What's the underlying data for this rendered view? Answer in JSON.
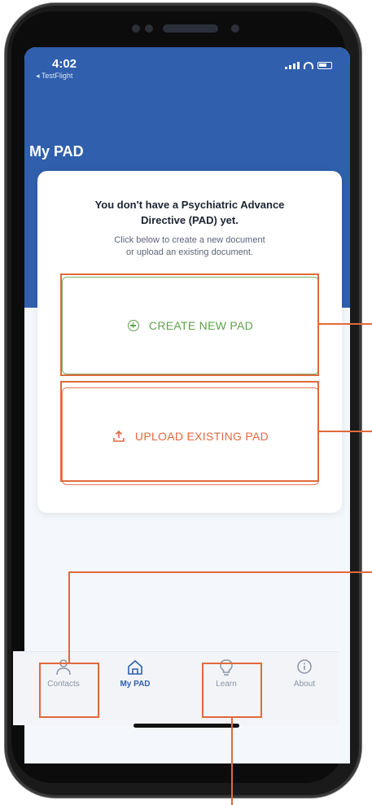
{
  "status_bar": {
    "time": "4:02",
    "back_app": "◂ TestFlight"
  },
  "header": {
    "title": "My PAD"
  },
  "card": {
    "title_line1": "You don't have a Psychiatric Advance",
    "title_line2": "Directive (PAD) yet.",
    "subtitle_line1": "Click below to create a new document",
    "subtitle_line2": "or upload an existing document."
  },
  "actions": {
    "create_label": "CREATE NEW PAD",
    "upload_label": "UPLOAD EXISTING PAD"
  },
  "tabs": [
    {
      "label": "Contacts",
      "icon": "person-icon"
    },
    {
      "label": "My PAD",
      "icon": "home-icon",
      "active": true
    },
    {
      "label": "Learn",
      "icon": "lightbulb-icon"
    },
    {
      "label": "About",
      "icon": "info-icon"
    }
  ],
  "colors": {
    "header_blue": "#2f5fad",
    "create_green": "#5fa14a",
    "upload_orange": "#e2693f",
    "annotation_orange": "#e06a3b"
  }
}
